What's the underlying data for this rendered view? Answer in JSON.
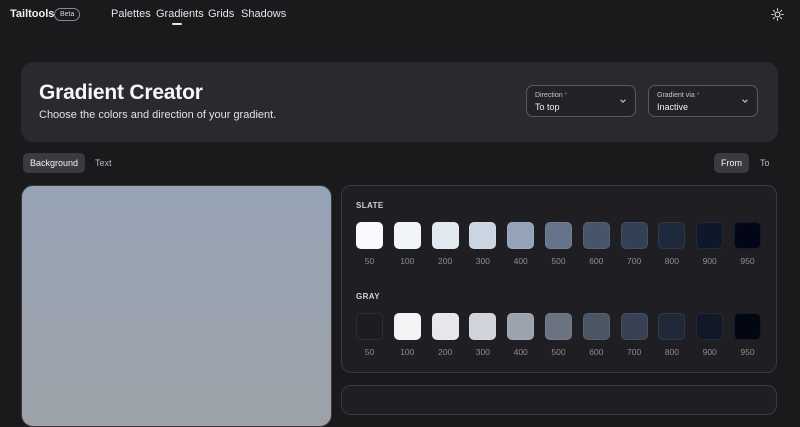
{
  "nav": {
    "logo": "Tailtools",
    "badge": "Beta",
    "links": [
      "Palettes",
      "Gradients",
      "Grids",
      "Shadows"
    ],
    "active": "Gradients",
    "theme_icon": "sun-icon"
  },
  "header": {
    "title": "Gradient Creator",
    "subtitle": "Choose the colors and direction of your gradient.",
    "direction": {
      "label": "Direction",
      "required": "*",
      "value": "To top"
    },
    "via": {
      "label": "Gradient via",
      "required": "*",
      "value": "Inactive"
    }
  },
  "tabs": {
    "left": [
      "Background",
      "Text"
    ],
    "left_active": "Background",
    "right": [
      "From",
      "To"
    ],
    "right_active": "From"
  },
  "preview": {
    "direction": "to top",
    "from": "#9da2a8",
    "to": "#96a3b6"
  },
  "palettes": [
    {
      "name": "SLATE",
      "shades": [
        "50",
        "100",
        "200",
        "300",
        "400",
        "500",
        "600",
        "700",
        "800",
        "900",
        "950"
      ],
      "colors": [
        "#f8fafc",
        "#f1f5f9",
        "#e2e8f0",
        "#cbd5e1",
        "#94a3b8",
        "#64748b",
        "#475569",
        "#334155",
        "#1e293b",
        "#0f172a",
        "#020617"
      ]
    },
    {
      "name": "GRAY",
      "shades": [
        "50",
        "100",
        "200",
        "300",
        "400",
        "500",
        "600",
        "700",
        "800",
        "900",
        "950"
      ],
      "colors": [
        "#1d1d21",
        "#f3f4f6",
        "#e5e7eb",
        "#d1d5db",
        "#9ca3af",
        "#6b7280",
        "#4b5563",
        "#374151",
        "#1f2937",
        "#111827",
        "#030712"
      ]
    }
  ]
}
